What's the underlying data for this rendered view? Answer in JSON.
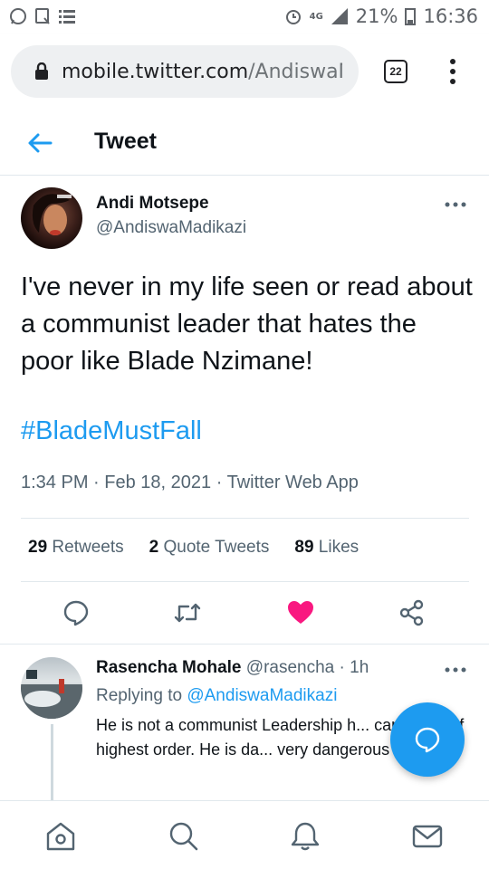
{
  "status_bar": {
    "battery": "21%",
    "time": "16:36",
    "network": "4G"
  },
  "browser": {
    "url_host": "mobile.twitter.com",
    "url_path": "/AndiswaMa",
    "tab_count": "22"
  },
  "header": {
    "title": "Tweet"
  },
  "tweet": {
    "author_name": "Andi Motsepe",
    "author_handle": "@AndiswaMadikazi",
    "text": "I've never in my life seen or read about a communist leader that hates the poor like Blade Nzimane!",
    "hashtag": "#BladeMustFall",
    "time": "1:34 PM",
    "date": "Feb 18, 2021",
    "source": "Twitter Web App",
    "separator": "·",
    "retweets_count": "29",
    "retweets_label": "Retweets",
    "quotes_count": "2",
    "quotes_label": "Quote Tweets",
    "likes_count": "89",
    "likes_label": "Likes"
  },
  "reply": {
    "author_name": "Rasencha Mohale",
    "author_handle": "@rasencha",
    "age": "· 1h",
    "replying_prefix": "Replying to",
    "replying_to": "@AndiswaMadikazi",
    "text": "He is not a communist Leadership h... capitalists of highest order. He is da... very dangerous"
  },
  "colors": {
    "accent": "#1d9bf0",
    "like": "#f91880",
    "text_secondary": "#536471"
  },
  "icons": {
    "back": "arrow-left-icon",
    "reply": "reply-bubble-icon",
    "retweet": "retweet-icon",
    "like": "heart-filled-icon",
    "share": "share-icon",
    "compose": "compose-reply-icon",
    "nav": [
      "home-icon",
      "search-icon",
      "notifications-icon",
      "messages-icon"
    ]
  }
}
